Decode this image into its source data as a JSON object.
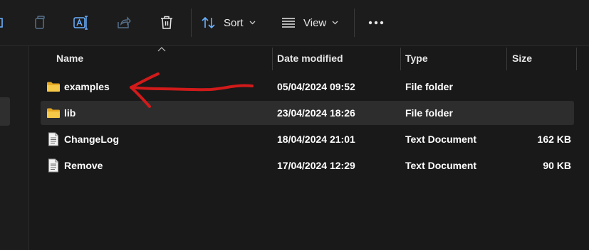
{
  "toolbar": {
    "buttons": [
      {
        "icon": "copy-icon"
      },
      {
        "icon": "rename-icon"
      },
      {
        "icon": "share-icon"
      },
      {
        "icon": "delete-icon"
      }
    ],
    "sort_label": "Sort",
    "view_label": "View",
    "more_icon": "more-options-icon"
  },
  "columns": {
    "name": "Name",
    "date_modified": "Date modified",
    "type": "Type",
    "size": "Size",
    "sorted_by": "name"
  },
  "files": [
    {
      "name": "examples",
      "date": "05/04/2024 09:52",
      "type": "File folder",
      "size": "",
      "icon": "folder-icon"
    },
    {
      "name": "lib",
      "date": "23/04/2024 18:26",
      "type": "File folder",
      "size": "",
      "icon": "folder-icon",
      "selected": true
    },
    {
      "name": "ChangeLog",
      "date": "18/04/2024 21:01",
      "type": "Text Document",
      "size": "162 KB",
      "icon": "text-document-icon"
    },
    {
      "name": "Remove",
      "date": "17/04/2024 12:29",
      "type": "Text Document",
      "size": "90 KB",
      "icon": "text-document-icon"
    }
  ],
  "annotation": {
    "icon": "red-arrow-annotation",
    "color": "#d11a1a"
  },
  "colors": {
    "background": "#191919",
    "folder": "#f7c948",
    "arrow": "#d11a1a",
    "selected_row": "#2d2d2d"
  }
}
